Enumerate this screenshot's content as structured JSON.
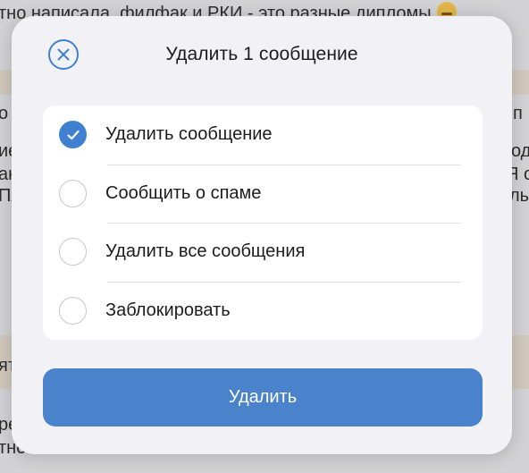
{
  "background": {
    "lines": [
      "тно написала, филфак и РКИ - это разные дипломы",
      "о",
      "п",
      "ие",
      "од",
      "ан",
      "Я с",
      "Пл",
      "ль",
      "ят",
      "ре",
      "тно"
    ]
  },
  "dialog": {
    "title": "Удалить 1 сообщение",
    "options": [
      {
        "label": "Удалить сообщение",
        "checked": true
      },
      {
        "label": "Сообщить о спаме",
        "checked": false
      },
      {
        "label": "Удалить все сообщения",
        "checked": false
      },
      {
        "label": "Заблокировать",
        "checked": false
      }
    ],
    "confirm_label": "Удалить"
  },
  "colors": {
    "accent": "#4a83cc",
    "radio_checked": "#3f80d1",
    "close_icon": "#3f80d1"
  },
  "icons": {
    "close": "close-circle-icon",
    "check": "checkmark-icon",
    "emoji": "grimace-emoji-icon"
  }
}
